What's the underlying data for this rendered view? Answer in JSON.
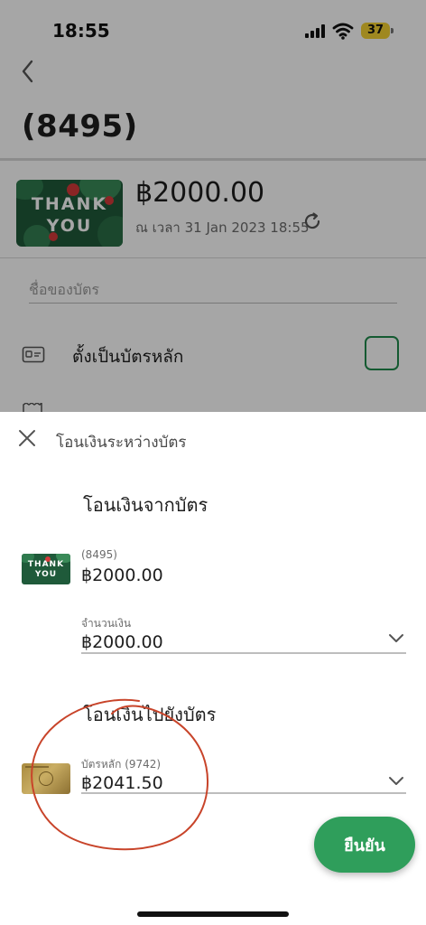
{
  "status_bar": {
    "time": "18:55",
    "battery": "37"
  },
  "header": {
    "title": "(8495)"
  },
  "card": {
    "art_text_line1": "THANK",
    "art_text_line2": "YOU",
    "balance": "฿2000.00",
    "updated_at": "ณ เวลา 31 Jan 2023 18:55"
  },
  "card_name_input": {
    "placeholder": "ชื่อของบัตร",
    "value": ""
  },
  "primary_card_row": {
    "label": "ตั้งเป็นบัตรหลัก",
    "checked": false
  },
  "sheet": {
    "title": "โอนเงินระหว่างบัตร",
    "from_section": {
      "heading": "โอนเงินจากบัตร",
      "card_name": "(8495)",
      "card_balance": "฿2000.00",
      "amount_label": "จำนวนเงิน",
      "amount_value": "฿2000.00"
    },
    "to_section": {
      "heading": "โอนเงินไปยังบัตร",
      "card_name": "บัตรหลัก (9742)",
      "card_balance": "฿2041.50"
    },
    "confirm_label": "ยืนยัน"
  },
  "icons": {
    "back": "chevron-left-icon",
    "refresh": "refresh-icon",
    "card": "card-icon",
    "close": "close-icon",
    "dropdown": "chevron-down-icon"
  },
  "colors": {
    "accent_green": "#2f9e5b",
    "checkbox_green": "#1f8a4c",
    "annotation_red": "#c8442a",
    "card_green": "#1f5a3a",
    "gold_card": "#b0944a"
  }
}
